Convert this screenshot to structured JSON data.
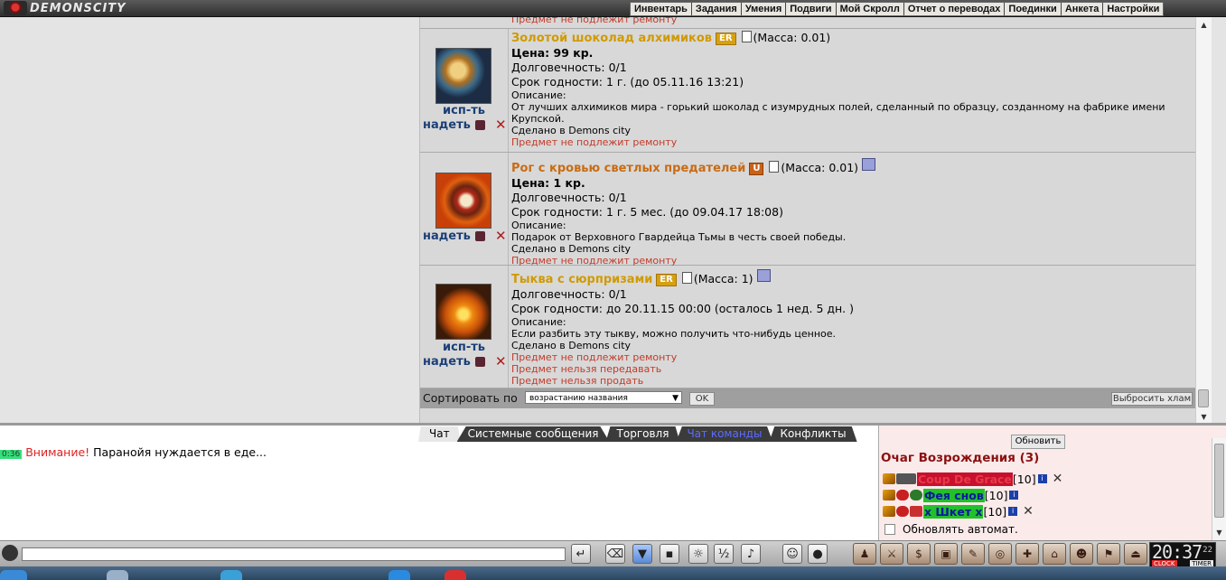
{
  "app": {
    "logo_text": "DEMONSCITY"
  },
  "topmenu": [
    "Инвентарь",
    "Задания",
    "Умения",
    "Подвиги",
    "Мой Скролл",
    "Отчет о переводах",
    "Поединки",
    "Анкета",
    "Настройки"
  ],
  "inventory": {
    "top_cut_text": "Предмет не подлежит ремонту",
    "items": [
      {
        "name": "Золотой шоколад алхимиков",
        "badge": "ER",
        "mass": "(Масса: 0.01)",
        "price": "Цена: 99 кр.",
        "durability": "Долговечность: 0/1",
        "expiry": "Срок годности: 1 г. (до 05.11.16 13:21)",
        "desc_label": "Описание:",
        "desc": "От лучших алхимиков мира - горький шоколад с изумрудных полей, сделанный по образцу, созданному на фабрике имени Крупской.",
        "made": "Сделано в Demons city",
        "notes": [
          "Предмет не подлежит ремонту"
        ],
        "use_label": "исп-ть",
        "wear_label": "надеть"
      },
      {
        "name": "Рог с кровью светлых предателей",
        "badge": "U",
        "mass": "(Масса: 0.01)",
        "price": "Цена: 1 кр.",
        "durability": "Долговечность: 0/1",
        "expiry": "Срок годности: 1 г. 5 мес. (до 09.04.17 18:08)",
        "desc_label": "Описание:",
        "desc": "Подарок от Верховного Гвардейца Тьмы в честь своей победы.",
        "made": "Сделано в Demons city",
        "notes": [
          "Предмет не подлежит ремонту"
        ],
        "wear_label": "надеть"
      },
      {
        "name": "Тыква с сюрпризами",
        "badge": "ER",
        "mass": "(Масса: 1)",
        "durability": "Долговечность: 0/1",
        "expiry": "Срок годности: до 20.11.15 00:00 (осталось 1 нед. 5 дн. )",
        "desc_label": "Описание:",
        "desc": "Если разбить эту тыкву, можно получить что-нибудь ценное.",
        "made": "Сделано в Demons city",
        "notes": [
          "Предмет не подлежит ремонту",
          "Предмет нельзя передавать",
          "Предмет нельзя продать"
        ],
        "use_label": "исп-ть",
        "wear_label": "надеть"
      }
    ],
    "sort": {
      "label": "Сортировать по",
      "selected": "возрастанию названия",
      "ok": "OK",
      "trash": "Выбросить хлам"
    }
  },
  "chat": {
    "tabs": [
      "Чат",
      "Системные сообщения",
      "Торговля",
      "Чат команды",
      "Конфликты"
    ],
    "messages": [
      {
        "time": "0:36",
        "prefix": "Внимание!",
        "text": "Паранойя нуждается в еде..."
      }
    ]
  },
  "side_panel": {
    "refresh": "Обновить",
    "title": "Очаг Возрождения (3)",
    "players": [
      {
        "name": "Coup De Grace",
        "level": "[10]",
        "bg": "#c8102e",
        "fg": "#e83a4a"
      },
      {
        "name": "Фея снов",
        "level": "[10]",
        "bg": "#22c02a",
        "fg": "#0a1a9a"
      },
      {
        "name": "x Шкет x",
        "level": "[10]",
        "bg": "#22c02a",
        "fg": "#0a1a9a"
      }
    ],
    "auto_refresh": "Обновлять автомат."
  },
  "clock": {
    "time": "20:37",
    "seconds": "22",
    "clock_label": "CLOCK",
    "timer_label": "TIMER"
  },
  "colors": {
    "gold_name": "#d09a00",
    "orange_name": "#c86c14",
    "link_blue": "#1c3f78",
    "note_red": "#c23b2a"
  }
}
